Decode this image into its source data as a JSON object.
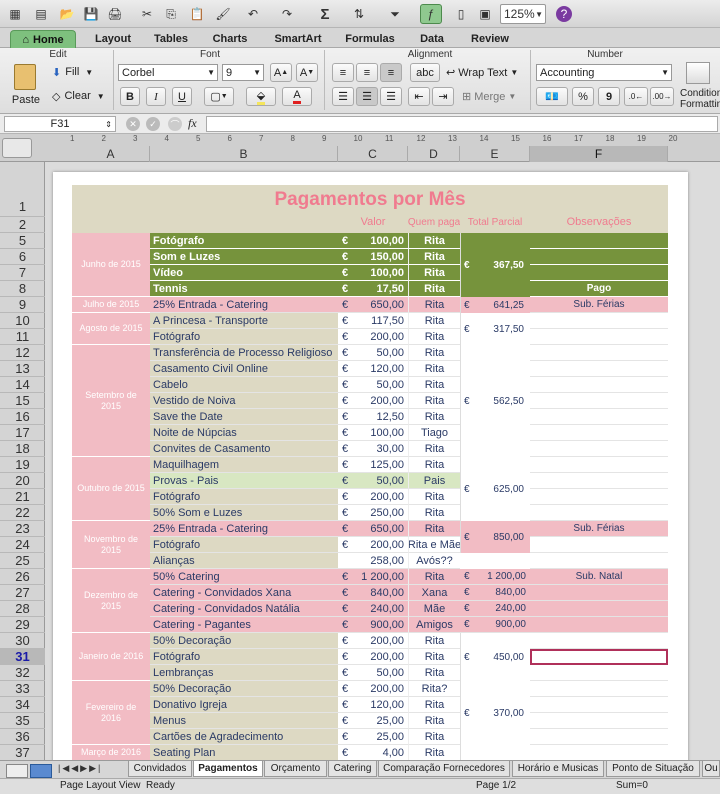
{
  "toolbar": {
    "zoom": "125%"
  },
  "tabs": [
    {
      "label": "Home",
      "active": true
    },
    {
      "label": "Layout"
    },
    {
      "label": "Tables"
    },
    {
      "label": "Charts"
    },
    {
      "label": "SmartArt"
    },
    {
      "label": "Formulas"
    },
    {
      "label": "Data"
    },
    {
      "label": "Review"
    }
  ],
  "ribbon": {
    "groups": {
      "edit": "Edit",
      "font": "Font",
      "alignment": "Alignment",
      "number": "Number"
    },
    "paste": "Paste",
    "fill": "Fill",
    "clear": "Clear",
    "font_name": "Corbel",
    "font_size": "9",
    "wrap": "Wrap Text",
    "merge": "Merge",
    "abc": "abc",
    "number_format": "Accounting",
    "conditional": "Conditional Formatting",
    "bold": "B",
    "italic": "I",
    "underline": "U",
    "pct": "%",
    "thousands": "9"
  },
  "formula_bar": {
    "cell_ref": "F31",
    "fx": "fx",
    "value": ""
  },
  "columns": [
    "A",
    "B",
    "C",
    "D",
    "E",
    "F"
  ],
  "ruler": [
    "1",
    "2",
    "3",
    "4",
    "5",
    "6",
    "7",
    "8",
    "9",
    "10",
    "11",
    "12",
    "13",
    "14",
    "15",
    "16",
    "17",
    "18",
    "19",
    "20"
  ],
  "rows": [
    "1",
    "2",
    "5",
    "6",
    "7",
    "8",
    "9",
    "10",
    "11",
    "12",
    "13",
    "14",
    "15",
    "16",
    "17",
    "18",
    "19",
    "20",
    "21",
    "22",
    "23",
    "24",
    "25",
    "26",
    "27",
    "28",
    "29",
    "30",
    "31",
    "32",
    "33",
    "34",
    "35",
    "36",
    "37"
  ],
  "sheet": {
    "title": "Pagamentos por Mês",
    "headers": {
      "valor": "Valor",
      "quem": "Quem paga",
      "total": "Total Parcial",
      "obs": "Observações"
    },
    "months": [
      {
        "label": "Junho de 2015",
        "rows": [
          {
            "desc": "Fotógrafo",
            "cur": "€",
            "val": "100,00",
            "who": "Rita"
          },
          {
            "desc": "Som e Luzes",
            "cur": "€",
            "val": "150,00",
            "who": "Rita"
          },
          {
            "desc": "Vídeo",
            "cur": "€",
            "val": "100,00",
            "who": "Rita"
          },
          {
            "desc": "Tennis",
            "cur": "€",
            "val": "17,50",
            "who": "Rita"
          }
        ],
        "total": "367,50",
        "obs": "Pago"
      },
      {
        "label": "Julho de 2015",
        "rows": [
          {
            "desc": "25% Entrada - Catering",
            "cur": "€",
            "val": "650,00",
            "who": "Rita"
          }
        ],
        "total": "641,25",
        "obs": "Sub. Férias"
      },
      {
        "label": "Agosto de 2015",
        "rows": [
          {
            "desc": "A Princesa - Transporte",
            "cur": "€",
            "val": "117,50",
            "who": "Rita"
          },
          {
            "desc": "Fotógrafo",
            "cur": "€",
            "val": "200,00",
            "who": "Rita"
          }
        ],
        "total": "317,50",
        "obs": ""
      },
      {
        "label": "Setembro de 2015",
        "rows": [
          {
            "desc": "Transferência de Processo Religioso",
            "cur": "€",
            "val": "50,00",
            "who": "Rita"
          },
          {
            "desc": "Casamento Civil Online",
            "cur": "€",
            "val": "120,00",
            "who": "Rita"
          },
          {
            "desc": "Cabelo",
            "cur": "€",
            "val": "50,00",
            "who": "Rita"
          },
          {
            "desc": "Vestido de Noiva",
            "cur": "€",
            "val": "200,00",
            "who": "Rita"
          },
          {
            "desc": "Save the Date",
            "cur": "€",
            "val": "12,50",
            "who": "Rita"
          },
          {
            "desc": "Noite de Núpcias",
            "cur": "€",
            "val": "100,00",
            "who": "Tiago"
          },
          {
            "desc": "Convites de Casamento",
            "cur": "€",
            "val": "30,00",
            "who": "Rita"
          }
        ],
        "total": "562,50",
        "obs": ""
      },
      {
        "label": "Outubro de 2015",
        "rows": [
          {
            "desc": "Maquilhagem",
            "cur": "€",
            "val": "125,00",
            "who": "Rita"
          },
          {
            "desc": "Provas - Pais",
            "cur": "€",
            "val": "50,00",
            "who": "Pais"
          },
          {
            "desc": "Fotógrafo",
            "cur": "€",
            "val": "200,00",
            "who": "Rita"
          },
          {
            "desc": "50% Som e Luzes",
            "cur": "€",
            "val": "250,00",
            "who": "Rita"
          }
        ],
        "total": "625,00",
        "obs": ""
      },
      {
        "label": "Novembro de 2015",
        "rows": [
          {
            "desc": "25% Entrada - Catering",
            "cur": "€",
            "val": "650,00",
            "who": "Rita"
          },
          {
            "desc": "Fotógrafo",
            "cur": "€",
            "val": "200,00",
            "who": "Rita e Mãe"
          },
          {
            "desc": "Alianças",
            "cur": "",
            "val": "258,00",
            "who": "Avós??"
          }
        ],
        "total": "850,00",
        "obs": "Sub. Férias"
      },
      {
        "label": "Dezembro de 2015",
        "rows": [
          {
            "desc": "50% Catering",
            "cur": "€",
            "val": "1 200,00",
            "who": "Rita",
            "tot": "1 200,00",
            "obs": "Sub. Natal"
          },
          {
            "desc": "Catering - Convidados Xana",
            "cur": "€",
            "val": "840,00",
            "who": "Xana",
            "tot": "840,00"
          },
          {
            "desc": "Catering - Convidados Natália",
            "cur": "€",
            "val": "240,00",
            "who": "Mãe",
            "tot": "240,00"
          },
          {
            "desc": "Catering - Pagantes",
            "cur": "€",
            "val": "900,00",
            "who": "Amigos",
            "tot": "900,00"
          }
        ],
        "total": "",
        "obs": ""
      },
      {
        "label": "Janeiro de 2016",
        "rows": [
          {
            "desc": "50% Decoração",
            "cur": "€",
            "val": "200,00",
            "who": "Rita"
          },
          {
            "desc": "Fotógrafo",
            "cur": "€",
            "val": "200,00",
            "who": "Rita"
          },
          {
            "desc": "Lembranças",
            "cur": "€",
            "val": "50,00",
            "who": "Rita"
          }
        ],
        "total": "450,00",
        "obs": ""
      },
      {
        "label": "Fevereiro de 2016",
        "rows": [
          {
            "desc": "50% Decoração",
            "cur": "€",
            "val": "200,00",
            "who": "Rita?"
          },
          {
            "desc": "Donativo Igreja",
            "cur": "€",
            "val": "120,00",
            "who": "Rita"
          },
          {
            "desc": "Menus",
            "cur": "€",
            "val": "25,00",
            "who": "Rita"
          },
          {
            "desc": "Cartões de Agradecimento",
            "cur": "€",
            "val": "25,00",
            "who": "Rita"
          }
        ],
        "total": "370,00",
        "obs": ""
      },
      {
        "label": "Março de 2016",
        "rows": [
          {
            "desc": "Seating Plan",
            "cur": "€",
            "val": "4,00",
            "who": "Rita"
          }
        ],
        "total": "",
        "obs": ""
      }
    ]
  },
  "sheet_tabs": [
    "Convidados",
    "Pagamentos",
    "Orçamento",
    "Catering",
    "Comparação Fornecedores",
    "Horário e Musicas",
    "Ponto de Situação",
    "Ou"
  ],
  "status": {
    "view": "Page Layout View",
    "ready": "Ready",
    "page": "Page 1/2",
    "sum": "Sum=0"
  },
  "colors": {
    "green": "#76933c",
    "pink": "#f2bcc4",
    "beige": "#ddd9c3",
    "lightgreen": "#d8e7c2",
    "title": "#f07b8f"
  }
}
